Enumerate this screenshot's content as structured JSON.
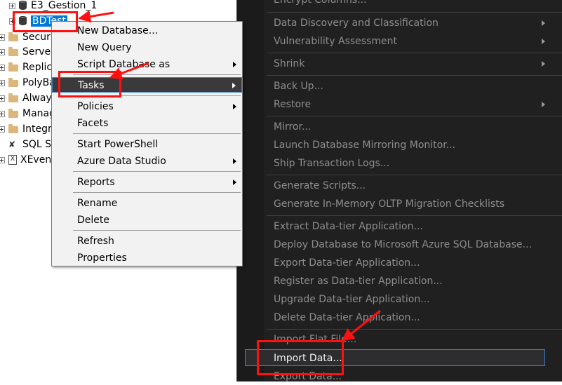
{
  "tree": {
    "nodes": [
      {
        "label": "E3_Gestion_1",
        "icon": "database-icon"
      },
      {
        "label": "BDTest",
        "icon": "database-icon"
      },
      {
        "label": "Secur",
        "icon": "folder-icon"
      },
      {
        "label": "Server",
        "icon": "folder-icon"
      },
      {
        "label": "Replic",
        "icon": "folder-icon"
      },
      {
        "label": "PolyBa",
        "icon": "folder-icon"
      },
      {
        "label": "Alway",
        "icon": "folder-icon"
      },
      {
        "label": "Manag",
        "icon": "folder-icon"
      },
      {
        "label": "Integr",
        "icon": "folder-icon"
      },
      {
        "label": "SQL Se",
        "icon": "sql-agent-icon"
      },
      {
        "label": "XEvent",
        "icon": "xevent-icon"
      }
    ]
  },
  "context_menu": {
    "items": [
      {
        "label": "New Database..."
      },
      {
        "label": "New Query"
      },
      {
        "label": "Script Database as",
        "submenu": true
      },
      {
        "label": "Tasks",
        "submenu": true,
        "highlighted": true
      },
      {
        "label": "Policies",
        "submenu": true
      },
      {
        "label": "Facets"
      },
      {
        "label": "Start PowerShell"
      },
      {
        "label": "Azure Data Studio",
        "submenu": true
      },
      {
        "label": "Reports",
        "submenu": true
      },
      {
        "label": "Rename"
      },
      {
        "label": "Delete"
      },
      {
        "label": "Refresh"
      },
      {
        "label": "Properties"
      }
    ]
  },
  "tasks_submenu": {
    "items": [
      {
        "label": "Encrypt Columns..."
      },
      {
        "label": "Data Discovery and Classification",
        "submenu": true
      },
      {
        "label": "Vulnerability Assessment",
        "submenu": true
      },
      {
        "label": "Shrink",
        "submenu": true
      },
      {
        "label": "Back Up..."
      },
      {
        "label": "Restore",
        "submenu": true
      },
      {
        "label": "Mirror..."
      },
      {
        "label": "Launch Database Mirroring Monitor..."
      },
      {
        "label": "Ship Transaction Logs..."
      },
      {
        "label": "Generate Scripts..."
      },
      {
        "label": "Generate In-Memory OLTP Migration Checklists"
      },
      {
        "label": "Extract Data-tier Application..."
      },
      {
        "label": "Deploy Database to Microsoft Azure SQL Database..."
      },
      {
        "label": "Export Data-tier Application..."
      },
      {
        "label": "Register as Data-tier Application..."
      },
      {
        "label": "Upgrade Data-tier Application..."
      },
      {
        "label": "Delete Data-tier Application..."
      },
      {
        "label": "Import Flat File..."
      },
      {
        "label": "Import Data...",
        "highlighted": true
      },
      {
        "label": "Export Data..."
      }
    ]
  },
  "colors": {
    "annotation": "#ff1010",
    "selection": "#0078d7",
    "submenu_background": "#202021",
    "highlight_border": "#3d7fd0"
  }
}
